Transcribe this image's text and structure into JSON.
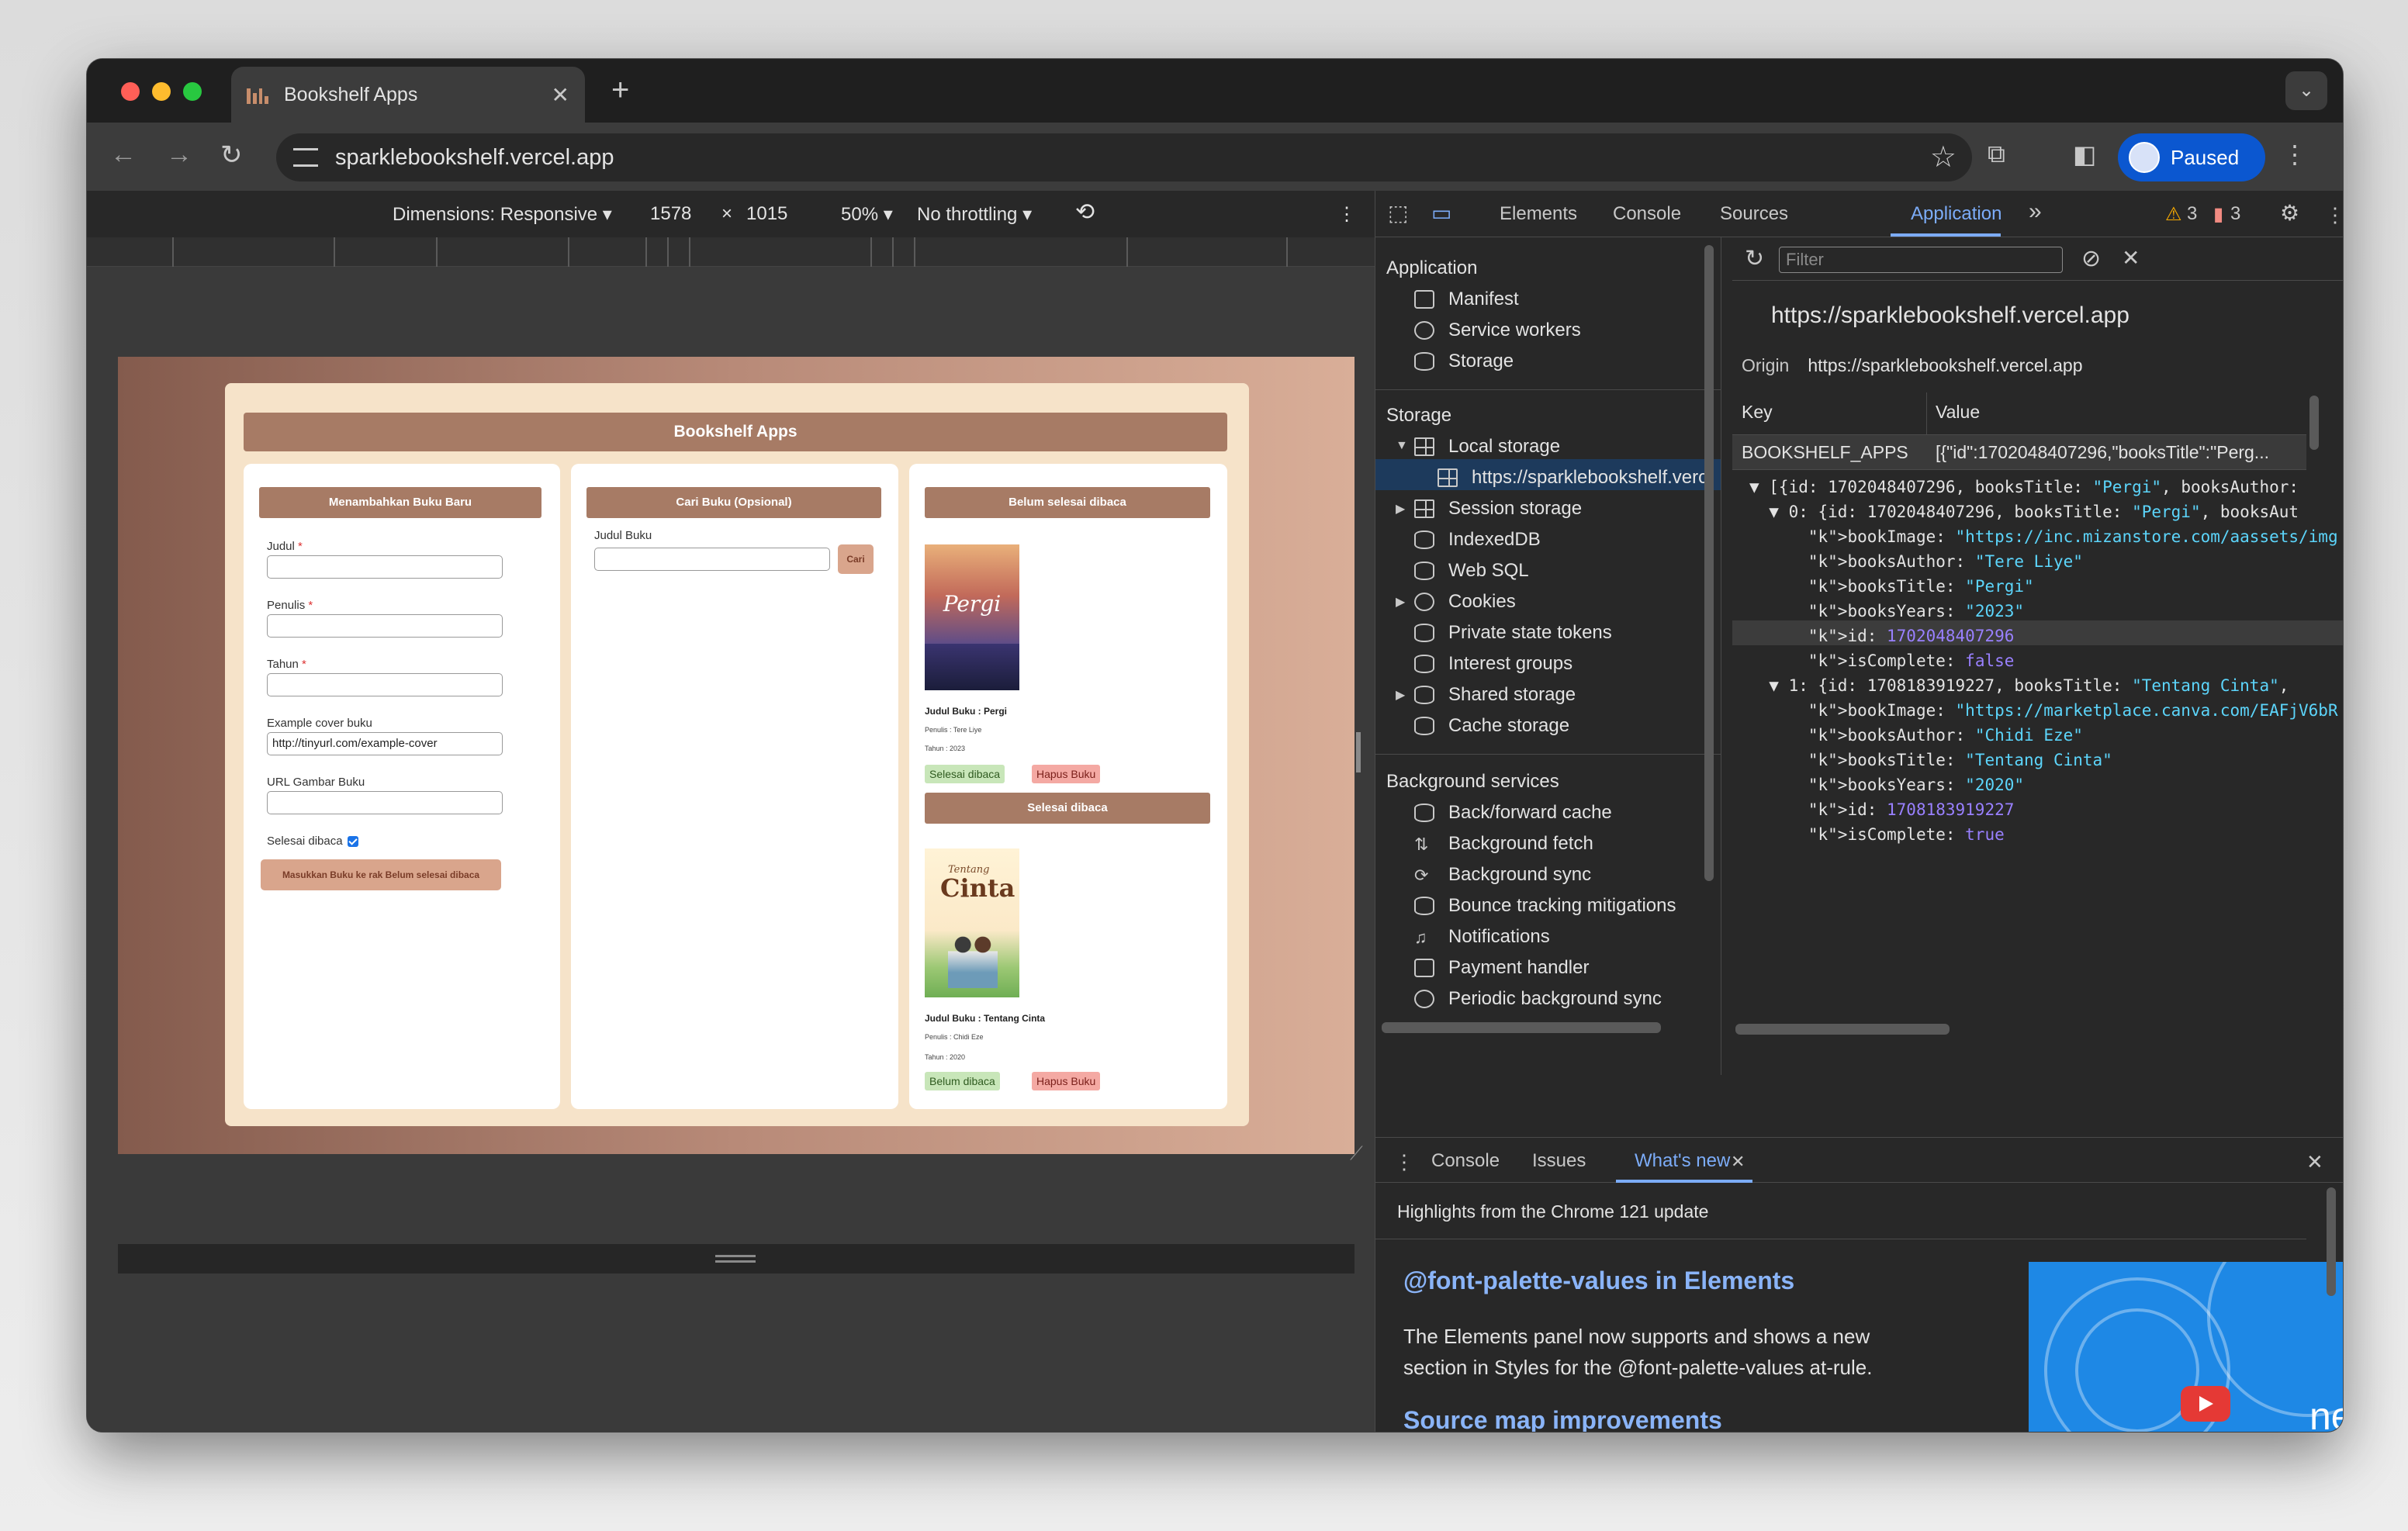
{
  "browser": {
    "tab_title": "Bookshelf Apps",
    "tab_close": "✕",
    "new_tab": "+",
    "url": "sparklebookshelf.vercel.app",
    "profile_label": "Paused",
    "traffic_colors": [
      "#ff5f57",
      "#febc2e",
      "#28c840"
    ]
  },
  "device_toolbar": {
    "dimensions": "Dimensions: Responsive ▾",
    "width": "1578",
    "times": "×",
    "height": "1015",
    "zoom": "50% ▾",
    "throttling": "No throttling ▾"
  },
  "app": {
    "title": "Bookshelf Apps",
    "add_form": {
      "heading": "Menambahkan Buku Baru",
      "title_label": "Judul",
      "author_label": "Penulis",
      "year_label": "Tahun",
      "cover_example_label": "Example cover buku",
      "cover_example_value": "http://tinyurl.com/example-cover",
      "image_url_label": "URL Gambar Buku",
      "complete_label": "Selesai dibaca",
      "submit_label": "Masukkan Buku ke rak Belum selesai dibaca",
      "required_mark": "*"
    },
    "search": {
      "heading": "Cari Buku (Opsional)",
      "label": "Judul Buku",
      "button": "Cari"
    },
    "unfinished": {
      "heading": "Belum selesai dibaca",
      "book": {
        "cover_title": "Pergi",
        "title": "Judul Buku : Pergi",
        "author": "Penulis : Tere Liye",
        "year": "Tahun : 2023",
        "toggle_button": "Selesai dibaca",
        "delete_button": "Hapus Buku"
      }
    },
    "finished": {
      "heading": "Selesai dibaca",
      "book": {
        "cover_small": "Tentang",
        "cover_title": "Cinta",
        "title": "Judul Buku : Tentang Cinta",
        "author": "Penulis : Chidi Eze",
        "year": "Tahun : 2020",
        "toggle_button": "Belum dibaca",
        "delete_button": "Hapus Buku"
      }
    }
  },
  "devtools": {
    "tabs": [
      "Elements",
      "Console",
      "Sources",
      "Application",
      "»"
    ],
    "warnings": "3",
    "errors": "3",
    "sidebar": {
      "application_header": "Application",
      "application_items": [
        "Manifest",
        "Service workers",
        "Storage"
      ],
      "storage_header": "Storage",
      "local_storage": "Local storage",
      "local_storage_origin": "https://sparklebookshelf.verc",
      "storage_items": [
        "Session storage",
        "IndexedDB",
        "Web SQL",
        "Cookies",
        "Private state tokens",
        "Interest groups",
        "Shared storage",
        "Cache storage"
      ],
      "background_header": "Background services",
      "background_items": [
        "Back/forward cache",
        "Background fetch",
        "Background sync",
        "Bounce tracking mitigations",
        "Notifications",
        "Payment handler",
        "Periodic background sync"
      ]
    },
    "main": {
      "filter_placeholder": "Filter",
      "origin_title": "https://sparklebookshelf.vercel.app",
      "origin_label": "Origin",
      "origin_value": "https://sparklebookshelf.vercel.app",
      "key_header": "Key",
      "value_header": "Value",
      "row_key": "BOOKSHELF_APPS",
      "row_value": "[{\"id\":1702048407296,\"booksTitle\":\"Perg...",
      "json_lines": [
        "▼ [{id: 1702048407296, booksTitle: \"Pergi\", booksAuthor:",
        "  ▼ 0: {id: 1702048407296, booksTitle: \"Pergi\", booksAut",
        "      bookImage: \"https://inc.mizanstore.com/aassets/img",
        "      booksAuthor: \"Tere Liye\"",
        "      booksTitle: \"Pergi\"",
        "      booksYears: \"2023\"",
        "      id: 1702048407296",
        "      isComplete: false",
        "  ▼ 1: {id: 1708183919227, booksTitle: \"Tentang Cinta\",",
        "      bookImage: \"https://marketplace.canva.com/EAFjV6bR",
        "      booksAuthor: \"Chidi Eze\"",
        "      booksTitle: \"Tentang Cinta\"",
        "      booksYears: \"2020\"",
        "      id: 1708183919227",
        "      isComplete: true"
      ]
    },
    "drawer": {
      "tabs": [
        "Console",
        "Issues",
        "What's new"
      ],
      "subtitle": "Highlights from the Chrome 121 update",
      "heading1": "@font-palette-values in Elements",
      "paragraph": "The Elements panel now supports and shows a new section in Styles for the @font-palette-values at-rule.",
      "heading2": "Source map improvements",
      "thumb_text": "new"
    }
  }
}
